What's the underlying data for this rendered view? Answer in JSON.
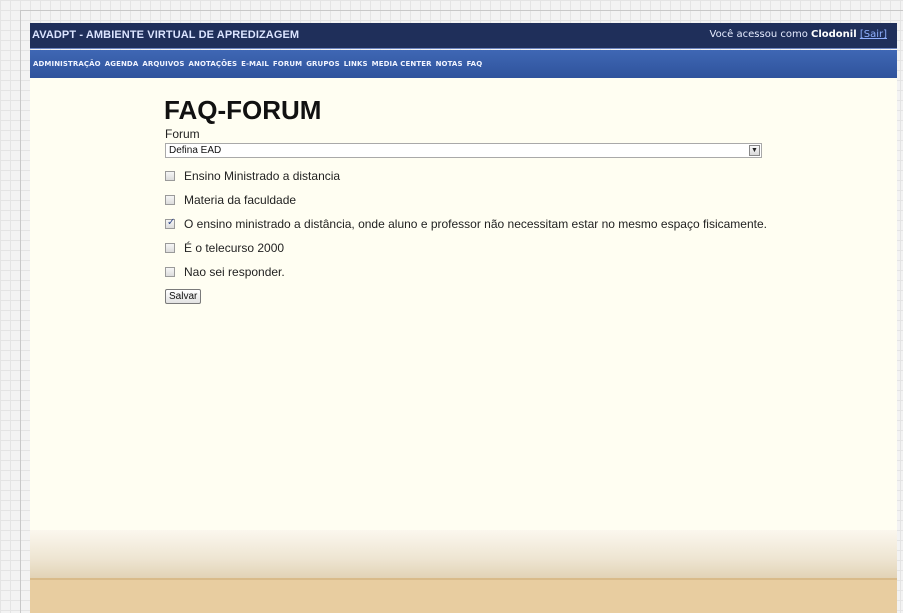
{
  "header": {
    "app_title": "AVADPT - AMBIENTE VIRTUAL DE APREDIZAGEM",
    "user_prefix": "Você acessou como ",
    "user_name": "Clodonil",
    "logout_label": "[Sair]"
  },
  "nav": {
    "items": [
      {
        "label": "ADMINISTRAÇÃO"
      },
      {
        "label": "AGENDA"
      },
      {
        "label": "ARQUIVOS"
      },
      {
        "label": "ANOTAÇÕES"
      },
      {
        "label": "E-MAIL"
      },
      {
        "label": "FORUM"
      },
      {
        "label": "GRUPOS"
      },
      {
        "label": "LINKS"
      },
      {
        "label": "MEDIA CENTER"
      },
      {
        "label": "NOTAS"
      },
      {
        "label": "FAQ"
      }
    ]
  },
  "main": {
    "title": "FAQ-FORUM",
    "forum_label": "Forum",
    "forum_select_value": "Defina EAD",
    "options": [
      {
        "label": "Ensino Ministrado a distancia",
        "checked": false
      },
      {
        "label": "Materia da faculdade",
        "checked": false
      },
      {
        "label": "O ensino ministrado a distância, onde aluno e professor não necessitam estar no mesmo espaço fisicamente.",
        "checked": true
      },
      {
        "label": "É o telecurso 2000",
        "checked": false
      },
      {
        "label": "Nao sei responder.",
        "checked": false
      }
    ],
    "save_label": "Salvar"
  },
  "colors": {
    "title_bar": "#1f2f5a",
    "nav_bar": "#3a5fa9",
    "content_bg": "#fffef2",
    "footer": "#e8cda0"
  }
}
